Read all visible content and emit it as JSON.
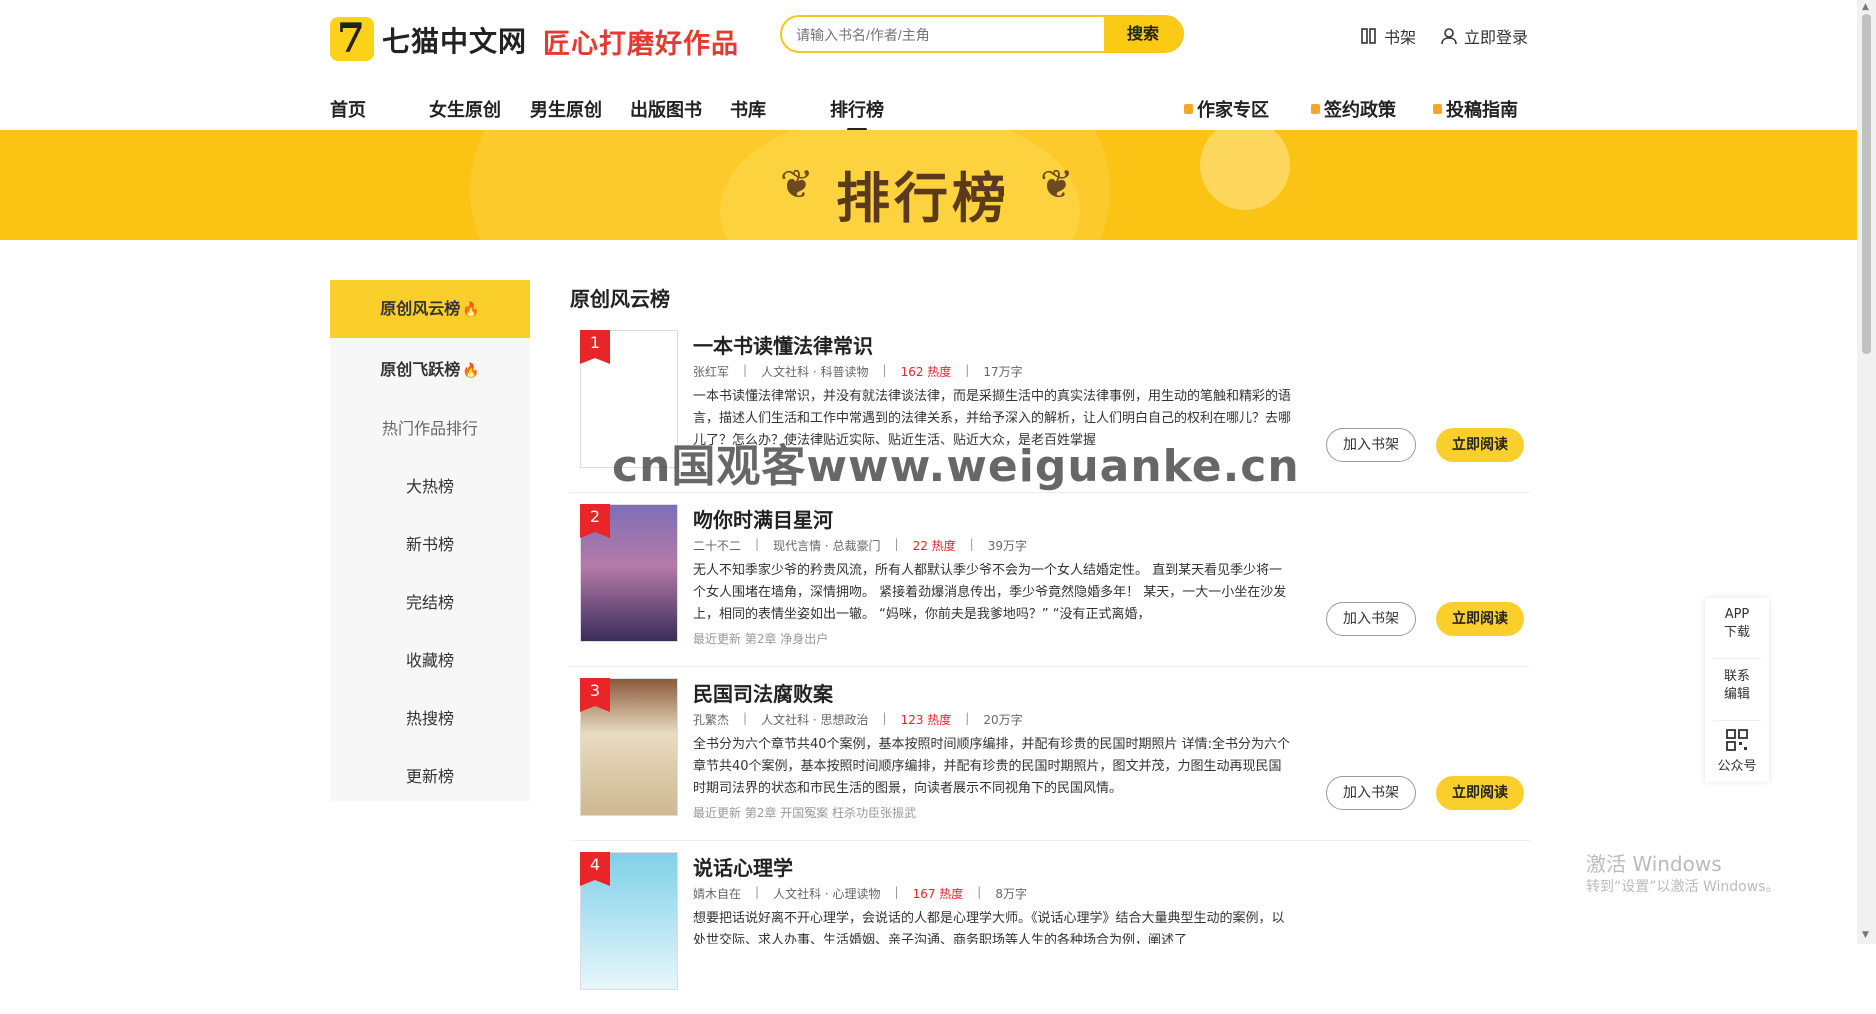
{
  "header": {
    "logo_text": "七猫中文网",
    "slogan": "匠心打磨好作品",
    "search_placeholder": "请输入书名/作者/主角",
    "search_button": "搜索",
    "bookshelf": "书架",
    "login": "立即登录"
  },
  "nav": {
    "items": [
      "首页",
      "女生原创",
      "男生原创",
      "出版图书",
      "书库",
      "排行榜"
    ],
    "active": "排行榜",
    "right": [
      "作家专区",
      "签约政策",
      "投稿指南"
    ]
  },
  "banner": {
    "title": "排行榜"
  },
  "sidebar": {
    "items": [
      "原创风云榜",
      "原创飞跃榜",
      "热门作品排行",
      "大热榜",
      "新书榜",
      "完结榜",
      "收藏榜",
      "热搜榜",
      "更新榜"
    ]
  },
  "main": {
    "section_title": "原创风云榜",
    "add_shelf_label": "加入书架",
    "read_label": "立即阅读",
    "books": [
      {
        "rank": "1",
        "title": "一本书读懂法律常识",
        "author": "张红军",
        "category": "人文社科 · 科普读物",
        "heat": "162 热度",
        "words": "17万字",
        "desc": "一本书读懂法律常识，并没有就法律谈法律，而是采撷生活中的真实法律事例，用生动的笔触和精彩的语言，描述人们生活和工作中常遇到的法律关系，并给予深入的解析，让人们明白自己的权利在哪儿？去哪儿了？怎么办？使法律贴近实际、贴近生活、贴近大众，是老百姓掌握",
        "update": ""
      },
      {
        "rank": "2",
        "title": "吻你时满目星河",
        "author": "二十不二",
        "category": "现代言情 · 总裁豪门",
        "heat": "22 热度",
        "words": "39万字",
        "desc": "无人不知季家少爷的矜贵风流，所有人都默认季少爷不会为一个女人结婚定性。 直到某天看见季少将一个女人围堵在墙角，深情拥吻。 紧接着劲爆消息传出，季少爷竟然隐婚多年！ 某天，一大一小坐在沙发上，相同的表情坐姿如出一辙。 “妈咪，你前夫是我爹地吗？” “没有正式离婚，",
        "update": "最近更新 第2章 净身出户"
      },
      {
        "rank": "3",
        "title": "民国司法腐败案",
        "author": "孔繁杰",
        "category": "人文社科 · 思想政治",
        "heat": "123 热度",
        "words": "20万字",
        "desc": "全书分为六个章节共40个案例，基本按照时间顺序编排，并配有珍贵的民国时期照片 详情:全书分为六个章节共40个案例，基本按照时间顺序编排，并配有珍贵的民国时期照片，图文并茂，力图生动再现民国时期司法界的状态和市民生活的图景，向读者展示不同视角下的民国风情。",
        "update": "最近更新 第2章 开国冤案 枉杀功臣张振武"
      },
      {
        "rank": "4",
        "title": "说话心理学",
        "author": "婧木自在",
        "category": "人文社科 · 心理读物",
        "heat": "167 热度",
        "words": "8万字",
        "desc": "想要把话说好离不开心理学，会说话的人都是心理学大师。《说话心理学》结合大量典型生动的案例，以处世交际、求人办事、生活婚姻、亲子沟通、商务职场等人生的各种场合为例，阐述了",
        "update": ""
      }
    ]
  },
  "float_panel": {
    "app": [
      "APP",
      "下载"
    ],
    "contact": [
      "联系",
      "编辑"
    ],
    "official": "公众号"
  },
  "watermark": "cn国观客www.weiguanke.cn",
  "windows": {
    "line1": "激活 Windows",
    "line2": "转到“设置”以激活 Windows。"
  },
  "colors": {
    "accent": "#fbcf2b",
    "brand_red": "#e6392f",
    "rank_red": "#e8262a"
  }
}
